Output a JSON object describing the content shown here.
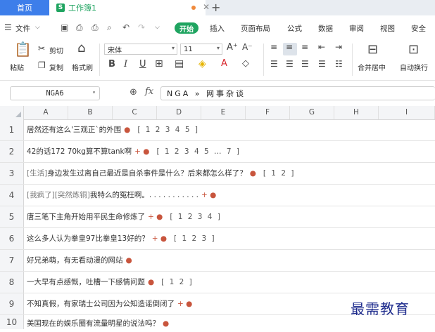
{
  "tabs": {
    "home": "首页",
    "workbook_icon": "S",
    "workbook": "工作簿1",
    "add": "+"
  },
  "menu": {
    "file": "文件",
    "start": "开始",
    "items": [
      "插入",
      "页面布局",
      "公式",
      "数据",
      "审阅",
      "视图",
      "安全"
    ]
  },
  "ribbon": {
    "paste": "粘贴",
    "cut": "剪切",
    "copy": "复制",
    "format_painter": "格式刷",
    "font_name": "宋体",
    "font_size": "11",
    "merge_center": "合并居中",
    "auto_wrap": "自动换行"
  },
  "formula_bar": {
    "cell_ref": "NGA6",
    "zoom_icon": "zoom-icon",
    "fx": "fx",
    "content": "NGA » 网事杂谈"
  },
  "columns": [
    "A",
    "B",
    "C",
    "D",
    "E",
    "F",
    "G",
    "H",
    "I"
  ],
  "rows": [
    {
      "n": "1",
      "prefix": "",
      "text": "居然还有这么'三观正`的外围",
      "mark": "●",
      "pages": "[ 1 2 3 4 5 ]"
    },
    {
      "n": "2",
      "prefix": "",
      "text": "42的话172 70kg算不算tank啊",
      "mark": "+ ●",
      "pages": "[ 1 2 3 4 5 … 7 ]"
    },
    {
      "n": "3",
      "prefix": "[生活]",
      "text": "身边发生过离自己最近是自杀事件是什么？后来都怎么样了？",
      "mark": "●",
      "pages": "[ 1 2 ]"
    },
    {
      "n": "4",
      "prefix": "[我疯了][突然炼铜]",
      "text": "我特么的冤枉啊。. . . . . . . . . . .",
      "mark": "+ ●",
      "pages": ""
    },
    {
      "n": "5",
      "prefix": "",
      "text": "唐三笔下主角开始用平民生命修炼了",
      "mark": "+ ●",
      "pages": "[ 1 2 3 4 ]"
    },
    {
      "n": "6",
      "prefix": "",
      "text": "这么多人认为拳皇97比拳皇13好的？",
      "mark": "+ ●",
      "pages": "[ 1 2 3 ]"
    },
    {
      "n": "7",
      "prefix": "",
      "text": "好兄弟萌，有无看动漫的网站",
      "mark": "●",
      "pages": ""
    },
    {
      "n": "8",
      "prefix": "",
      "text": "一大早有点感慨，吐槽一下感情问题",
      "mark": "●",
      "pages": "[ 1 2 ]"
    },
    {
      "n": "9",
      "prefix": "",
      "text": "不知真假，有家瑞士公司因为公知造谣倒闭了",
      "mark": "+ ●",
      "pages": ""
    },
    {
      "n": "10",
      "prefix": "",
      "text": "美国现在的娱乐圈有流量明星的说法吗？",
      "mark": "●",
      "pages": ""
    }
  ],
  "watermark": "最需教育",
  "colors": {
    "accent_blue": "#3d7eea",
    "accent_green": "#1fa460",
    "marker": "#c8553d"
  }
}
